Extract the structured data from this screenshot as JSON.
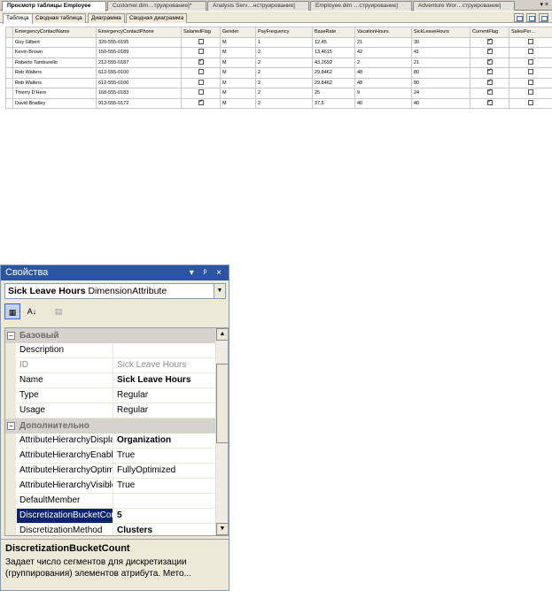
{
  "doc_tabs": [
    "Просмотр таблицы Employee",
    "Customer.dim…труирование]*",
    "Analysis Serv…нструирование]",
    "Employee.dim …струирование]",
    "Adventure Wor…струирование]"
  ],
  "doc_tab_controls": "▾ ×",
  "view_tabs": [
    "Таблица",
    "Сводная таблица",
    "Диаграмма",
    "Сводная диаграмма"
  ],
  "table": {
    "columns": [
      "EmergencyContactName",
      "EmergencyContactPhone",
      "SalariedFlag",
      "Gender",
      "PayFrequency",
      "BaseRate",
      "VacationHours",
      "SickLeaveHours",
      "CurrentFlag",
      "SalesPer…"
    ],
    "rows": [
      [
        "Guy Gilbert",
        "320-555-0195",
        false,
        "M",
        "1",
        "12,45",
        "21",
        "30",
        true,
        false
      ],
      [
        "Kevin Brown",
        "150-555-0189",
        false,
        "M",
        "2",
        "13,4615",
        "42",
        "41",
        true,
        false
      ],
      [
        "Roberto Tamburello",
        "212-555-0187",
        true,
        "M",
        "2",
        "43,2692",
        "2",
        "21",
        true,
        false
      ],
      [
        "Rob Walters",
        "612-555-0100",
        false,
        "M",
        "2",
        "29,8462",
        "48",
        "80",
        true,
        false
      ],
      [
        "Rob Walters",
        "612-555-0100",
        false,
        "M",
        "2",
        "29,8462",
        "48",
        "80",
        true,
        false
      ],
      [
        "Thierry D'Hers",
        "168-555-0183",
        false,
        "M",
        "2",
        "25",
        "9",
        "24",
        true,
        false
      ],
      [
        "David Bradley",
        "913-555-0172",
        true,
        "M",
        "2",
        "37,5",
        "40",
        "40",
        true,
        false
      ]
    ]
  },
  "properties": {
    "title": "Свойства",
    "title_buttons": "▾ ᵖ ×",
    "object_name": "Sick Leave Hours",
    "object_type": "DimensionAttribute",
    "toolbar": {
      "categorized": "▦",
      "alphabetical": "A↓",
      "pages": "▤"
    },
    "categories": [
      {
        "name": "Базовый",
        "toggle": "−",
        "items": [
          {
            "name": "Description",
            "value": "",
            "readonly": false,
            "bold": false
          },
          {
            "name": "ID",
            "value": "Sick Leave Hours",
            "readonly": true,
            "bold": false
          },
          {
            "name": "Name",
            "value": "Sick Leave Hours",
            "readonly": false,
            "bold": true
          },
          {
            "name": "Type",
            "value": "Regular",
            "readonly": false,
            "bold": false
          },
          {
            "name": "Usage",
            "value": "Regular",
            "readonly": false,
            "bold": false
          }
        ]
      },
      {
        "name": "Дополнительно",
        "toggle": "−",
        "items": [
          {
            "name": "AttributeHierarchyDisplayFolder",
            "value": "Organization",
            "readonly": false,
            "bold": true
          },
          {
            "name": "AttributeHierarchyEnabled",
            "value": "True",
            "readonly": false,
            "bold": false
          },
          {
            "name": "AttributeHierarchyOptimizedState",
            "value": "FullyOptimized",
            "readonly": false,
            "bold": false
          },
          {
            "name": "AttributeHierarchyVisible",
            "value": "True",
            "readonly": false,
            "bold": false
          },
          {
            "name": "DefaultMember",
            "value": "",
            "readonly": false,
            "bold": false
          },
          {
            "name": "DiscretizationBucketCount",
            "value": "5",
            "readonly": false,
            "bold": true,
            "selected": true
          },
          {
            "name": "DiscretizationMethod",
            "value": "Clusters",
            "readonly": false,
            "bold": true
          }
        ]
      }
    ],
    "description": {
      "title": "DiscretizationBucketCount",
      "text": "Задает число сегментов для дискретизации (группирования) элементов атрибута. Мето..."
    }
  },
  "colors": {
    "title_bar": "#2b55a0",
    "selection": "#0a246a",
    "chrome": "#ece9d8"
  }
}
